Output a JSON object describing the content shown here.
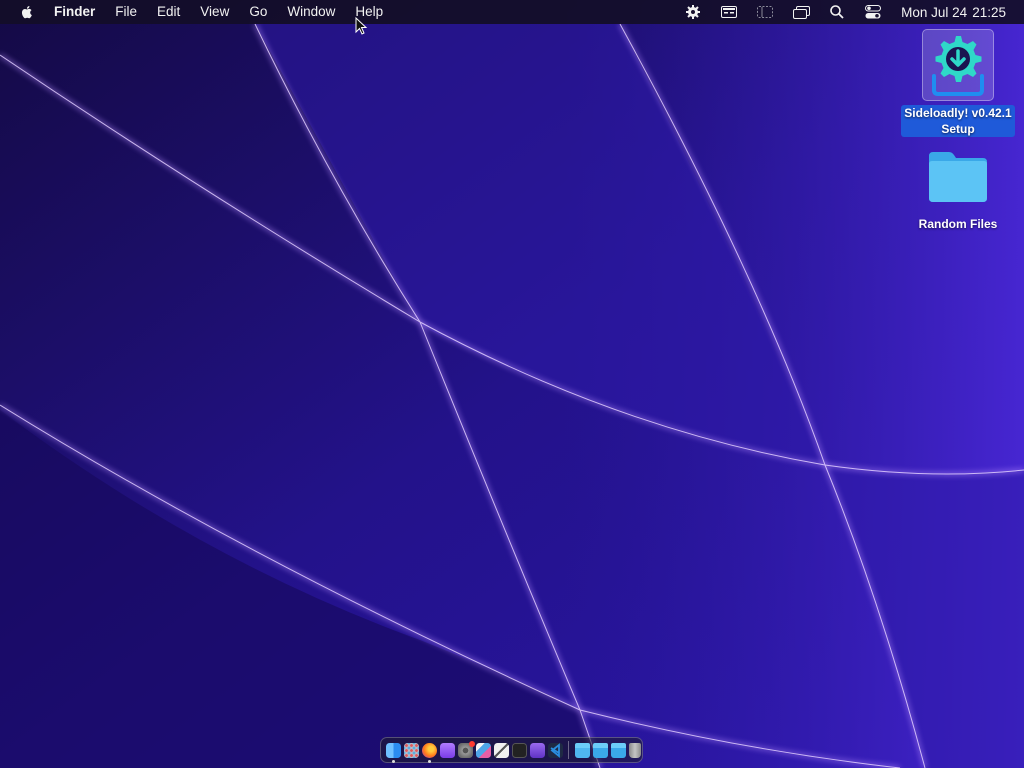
{
  "menubar": {
    "app_name": "Finder",
    "items": [
      "File",
      "Edit",
      "View",
      "Go",
      "Window",
      "Help"
    ],
    "tray_icons": [
      "settings-gear-icon",
      "keyboard-input-icon",
      "sidebar-icon",
      "screen-mirroring-icon",
      "spotlight-search-icon",
      "control-center-icon"
    ],
    "clock_date": "Mon Jul 24",
    "clock_time": "21:25"
  },
  "desktop": {
    "icons": [
      {
        "name": "sideloadly-setup",
        "label_line1": "Sideloadly! v0.42.1",
        "label_line2": "Setup",
        "selected": true
      },
      {
        "name": "random-files-folder",
        "label_line1": "Random Files",
        "selected": false
      }
    ]
  },
  "dock": {
    "apps": [
      {
        "name": "finder",
        "color": "#2b8cf0",
        "running": true
      },
      {
        "name": "launchpad",
        "color": "#b9b9c6"
      },
      {
        "name": "firefox",
        "color": "#ff7a1a",
        "running": true
      },
      {
        "name": "podcasts",
        "color": "#8e5cf0"
      },
      {
        "name": "system-settings",
        "color": "#8a8a8a"
      },
      {
        "name": "photo-app",
        "color": "#4fa5e8"
      },
      {
        "name": "textedit",
        "color": "#f0f0f0"
      },
      {
        "name": "terminal",
        "color": "#222222"
      },
      {
        "name": "visual-studio",
        "color": "#7c4dd6"
      },
      {
        "name": "vscode",
        "color": "#2a8de0"
      }
    ],
    "folders": [
      {
        "name": "documents-folder",
        "color": "#4fb7ef"
      },
      {
        "name": "downloads-folder",
        "color": "#3aa9ea"
      },
      {
        "name": "applications-folder",
        "color": "#3aa9ea"
      }
    ],
    "trash": {
      "name": "trash",
      "color": "#9a9a9a"
    }
  }
}
